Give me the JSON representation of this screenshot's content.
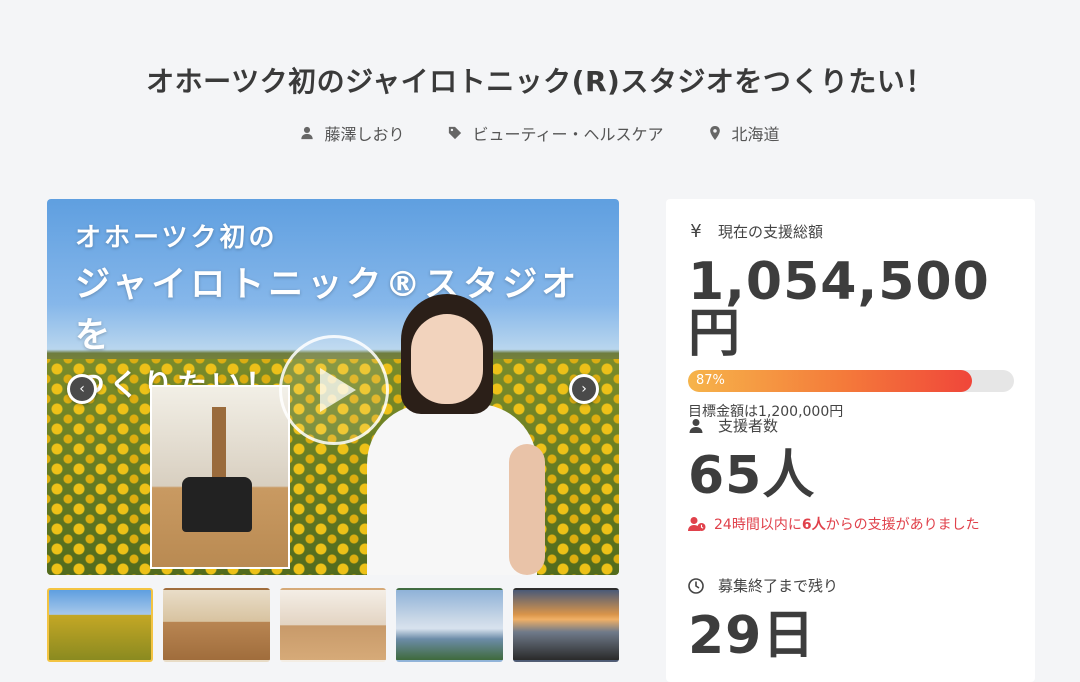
{
  "project": {
    "title": "オホーツク初のジャイロトニック(R)スタジオをつくりたい！",
    "owner": "藤澤しおり",
    "category": "ビューティー・ヘルスケア",
    "location": "北海道"
  },
  "hero": {
    "line1": "オホーツク初の",
    "line2": "ジャイロトニック®スタジオを",
    "line3": "つくりたい！",
    "prev_arrow": "‹",
    "next_arrow": "›"
  },
  "thumbnails": [
    {
      "name": "thumbnail-1",
      "active": true
    },
    {
      "name": "thumbnail-2",
      "active": false
    },
    {
      "name": "thumbnail-3",
      "active": false
    },
    {
      "name": "thumbnail-4",
      "active": false
    },
    {
      "name": "thumbnail-5",
      "active": false
    }
  ],
  "funding": {
    "label": "現在の支援総額",
    "icon_glyph": "¥",
    "amount": "1,054,500円",
    "progress_percent": 87,
    "progress_label": "87%",
    "goal_text": "目標金額は1,200,000円"
  },
  "supporters": {
    "label": "支援者数",
    "count": "65人",
    "recent_prefix": "24時間以内に",
    "recent_count": "6人",
    "recent_suffix": "からの支援がありました"
  },
  "remaining": {
    "label": "募集終了まで残り",
    "days": "29日"
  },
  "colors": {
    "accent_red": "#e0414b",
    "progress_start": "#f6b44a",
    "progress_end": "#f0463a",
    "active_thumb_border": "#f3c442"
  }
}
